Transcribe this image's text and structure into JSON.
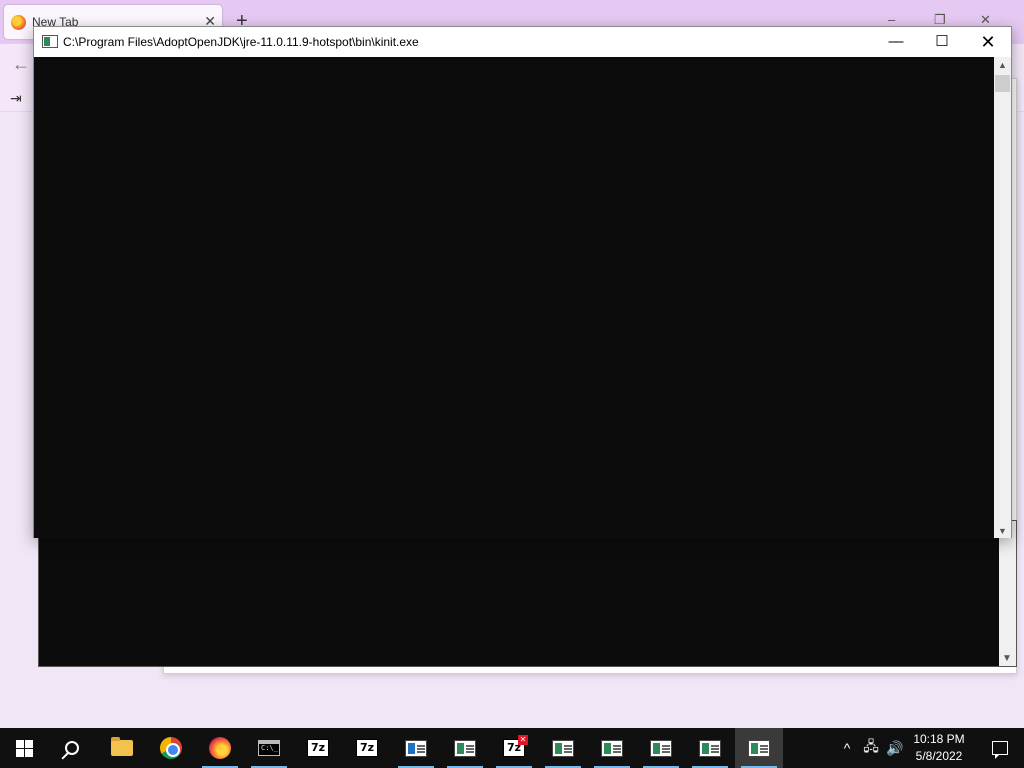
{
  "firefox": {
    "tab_label": "New Tab",
    "tab_close": "✕",
    "new_tab": "+",
    "back": "←",
    "import_icon": "⇥",
    "win_min": "–",
    "win_max": "❐",
    "win_close": "✕"
  },
  "console": {
    "title": "C:\\Program Files\\AdoptOpenJDK\\jre-11.0.11.9-hotspot\\bin\\kinit.exe",
    "minimize": "—",
    "maximize": "☐",
    "close": "✕",
    "scroll_up": "▲",
    "scroll_down": "▼"
  },
  "taskbar": {
    "cmd_label": "C:\\_",
    "sevenzip_label": "7z",
    "sevenzip_error_badge": "✕",
    "tray_chevron": "^",
    "tray_network": "🖧",
    "tray_volume": "🔊",
    "time": "10:18 PM",
    "date": "5/8/2022"
  },
  "colors": {
    "taskbar_bg": "#101010",
    "console_bg": "#0c0c0c",
    "firefox_tabstrip": "#e6c9f2",
    "active_indicator": "#76b9ed"
  }
}
